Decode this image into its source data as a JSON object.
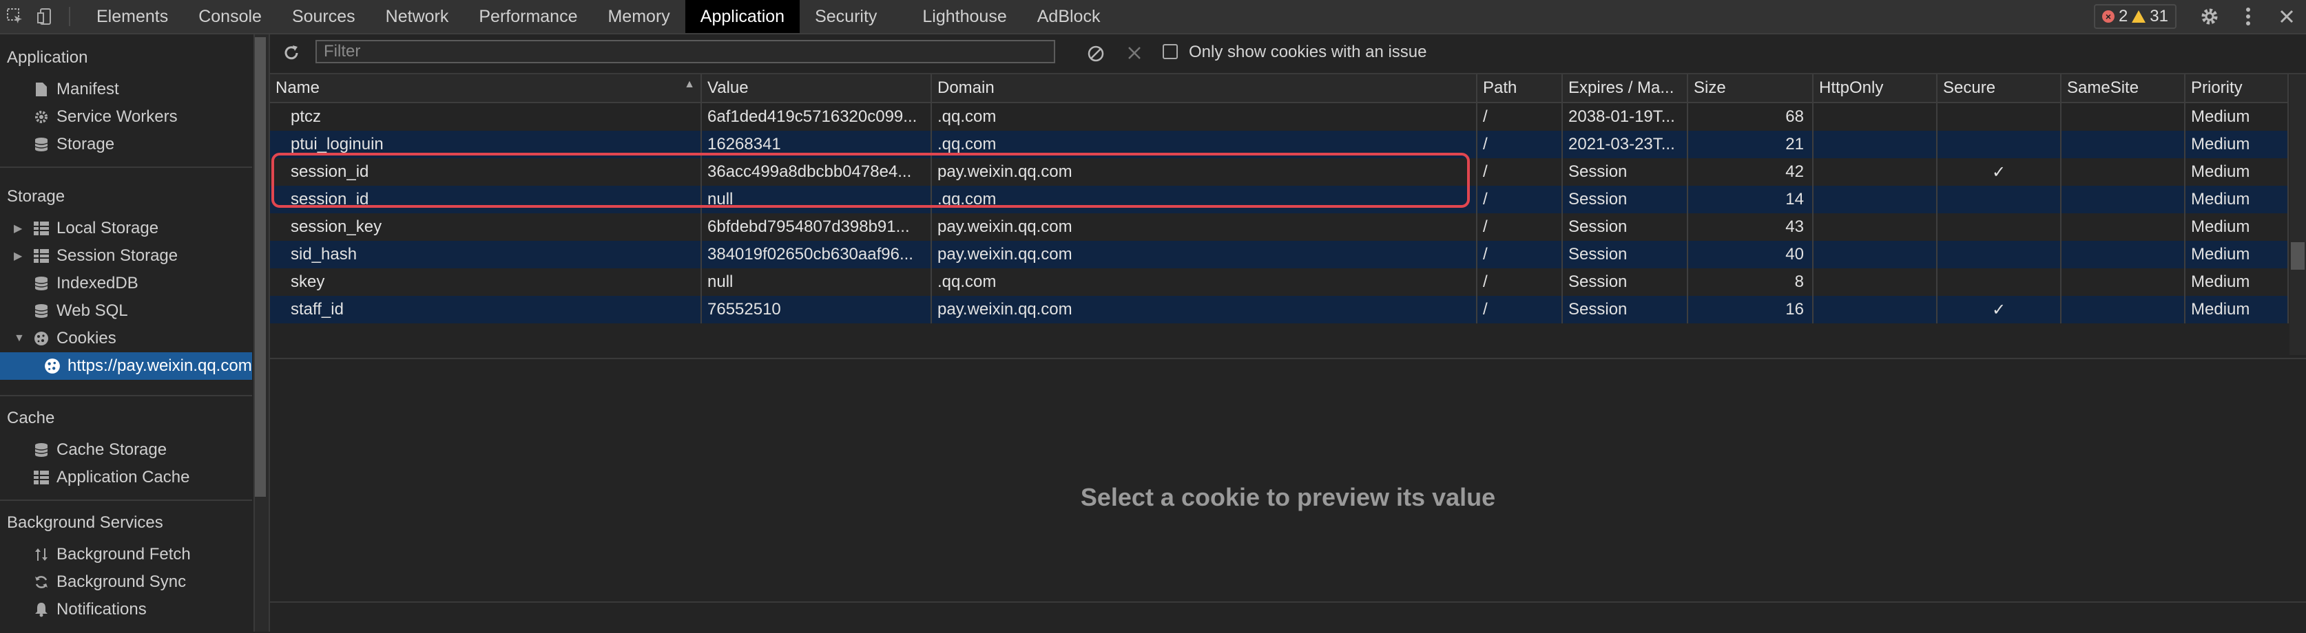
{
  "tabs": [
    "Elements",
    "Console",
    "Sources",
    "Network",
    "Performance",
    "Memory",
    "Application",
    "Security",
    "Lighthouse",
    "AdBlock"
  ],
  "active_tab": "Application",
  "status": {
    "errors": "2",
    "warnings": "31"
  },
  "sidebar": {
    "application_title": "Application",
    "application_items": [
      "Manifest",
      "Service Workers",
      "Storage"
    ],
    "storage_title": "Storage",
    "storage_items": [
      "Local Storage",
      "Session Storage",
      "IndexedDB",
      "Web SQL",
      "Cookies"
    ],
    "cookie_origin": "https://pay.weixin.qq.com",
    "cache_title": "Cache",
    "cache_items": [
      "Cache Storage",
      "Application Cache"
    ],
    "bg_title": "Background Services",
    "bg_items": [
      "Background Fetch",
      "Background Sync",
      "Notifications"
    ]
  },
  "toolbar": {
    "filter_placeholder": "Filter",
    "only_issues_label": "Only show cookies with an issue"
  },
  "table": {
    "columns": [
      "Name",
      "Value",
      "Domain",
      "Path",
      "Expires / Ma...",
      "Size",
      "HttpOnly",
      "Secure",
      "SameSite",
      "Priority"
    ],
    "rows": [
      {
        "name": "ptcz",
        "value": "6af1ded419c5716320c099...",
        "domain": ".qq.com",
        "path": "/",
        "expires": "2038-01-19T...",
        "size": "68",
        "httponly": "",
        "secure": "",
        "samesite": "",
        "priority": "Medium"
      },
      {
        "name": "ptui_loginuin",
        "value": "16268341",
        "domain": ".qq.com",
        "path": "/",
        "expires": "2021-03-23T...",
        "size": "21",
        "httponly": "",
        "secure": "",
        "samesite": "",
        "priority": "Medium"
      },
      {
        "name": "session_id",
        "value": "36acc499a8dbcbb0478e4...",
        "domain": "pay.weixin.qq.com",
        "path": "/",
        "expires": "Session",
        "size": "42",
        "httponly": "",
        "secure": "✓",
        "samesite": "",
        "priority": "Medium"
      },
      {
        "name": "session_id",
        "value": "null",
        "domain": ".qq.com",
        "path": "/",
        "expires": "Session",
        "size": "14",
        "httponly": "",
        "secure": "",
        "samesite": "",
        "priority": "Medium"
      },
      {
        "name": "session_key",
        "value": "6bfdebd7954807d398b91...",
        "domain": "pay.weixin.qq.com",
        "path": "/",
        "expires": "Session",
        "size": "43",
        "httponly": "",
        "secure": "",
        "samesite": "",
        "priority": "Medium"
      },
      {
        "name": "sid_hash",
        "value": "384019f02650cb630aaf96...",
        "domain": "pay.weixin.qq.com",
        "path": "/",
        "expires": "Session",
        "size": "40",
        "httponly": "",
        "secure": "",
        "samesite": "",
        "priority": "Medium"
      },
      {
        "name": "skey",
        "value": "null",
        "domain": ".qq.com",
        "path": "/",
        "expires": "Session",
        "size": "8",
        "httponly": "",
        "secure": "",
        "samesite": "",
        "priority": "Medium"
      },
      {
        "name": "staff_id",
        "value": "76552510",
        "domain": "pay.weixin.qq.com",
        "path": "/",
        "expires": "Session",
        "size": "16",
        "httponly": "",
        "secure": "✓",
        "samesite": "",
        "priority": "Medium"
      }
    ]
  },
  "preview_message": "Select a cookie to preview its value",
  "colors": {
    "selected": "#1c5a97",
    "highlight": "#e1464f",
    "active_tab": "#000000"
  }
}
